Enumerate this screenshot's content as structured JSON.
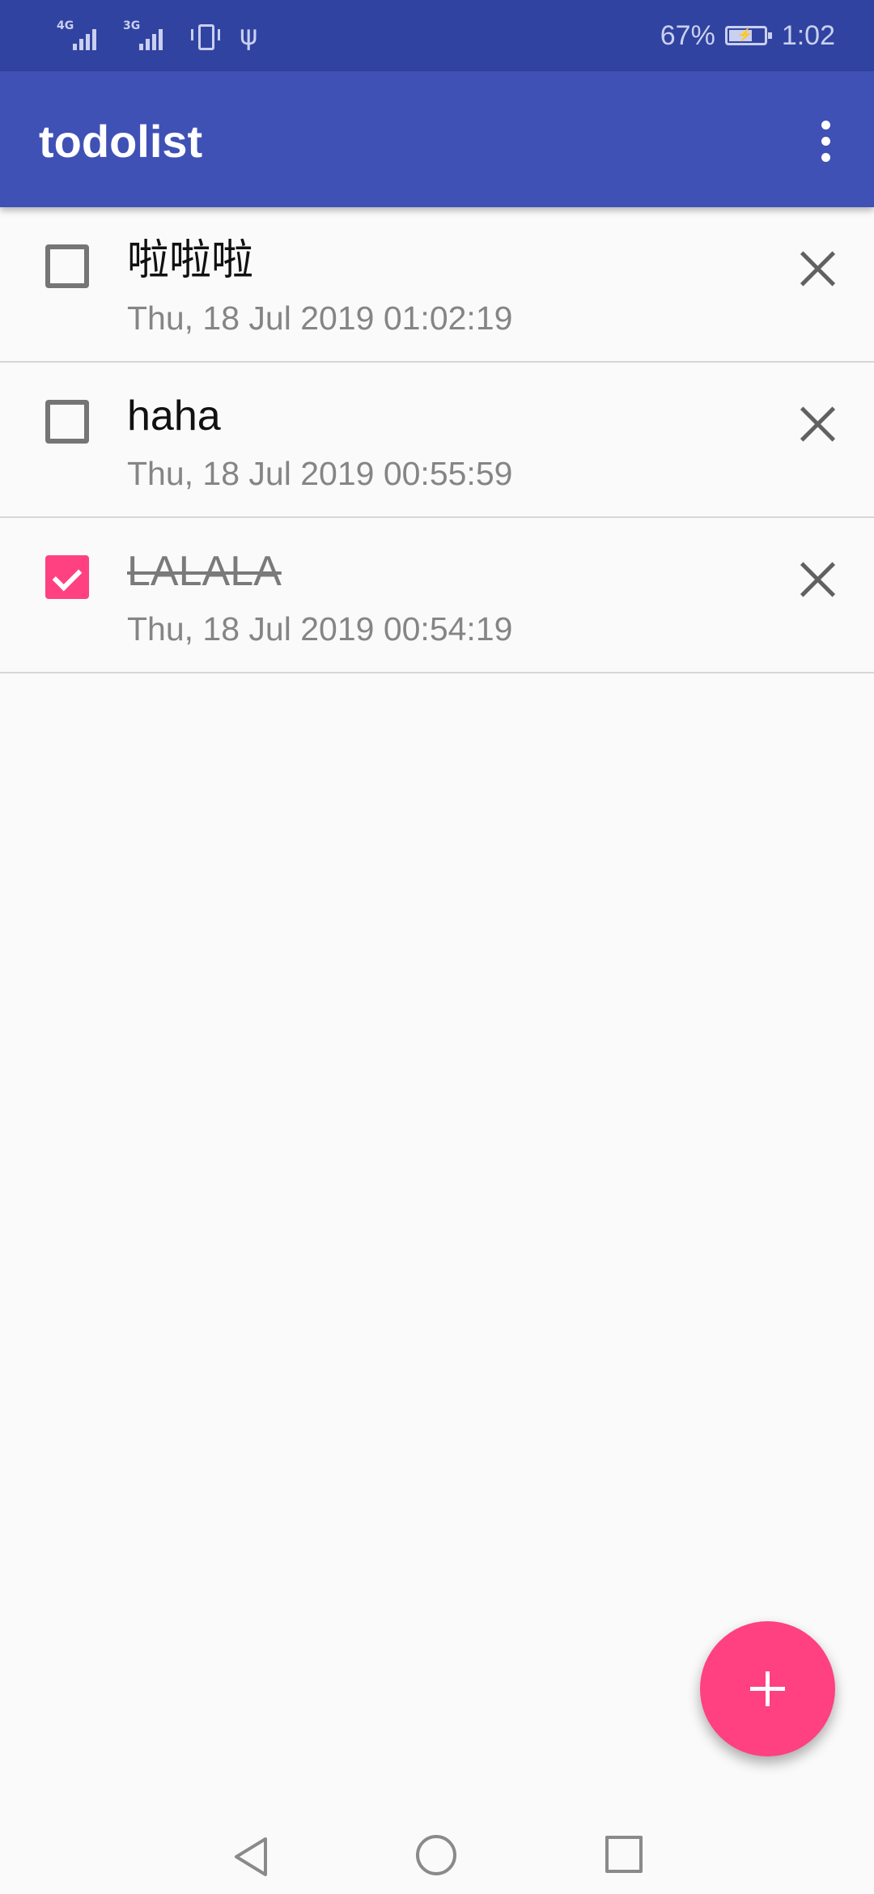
{
  "status_bar": {
    "network_1": "4G",
    "network_2": "3G",
    "battery_percent": "67%",
    "battery_level": 0.67,
    "time": "1:02"
  },
  "app_bar": {
    "title": "todolist",
    "overflow_icon": "more-vert-icon"
  },
  "todos": [
    {
      "title": "啦啦啦",
      "date": "Thu, 18 Jul 2019 01:02:19",
      "checked": false
    },
    {
      "title": "haha",
      "date": "Thu, 18 Jul 2019 00:55:59",
      "checked": false
    },
    {
      "title": "LALALA",
      "date": "Thu, 18 Jul 2019 00:54:19",
      "checked": true
    }
  ],
  "fab": {
    "icon": "add-icon"
  },
  "nav_bar": {
    "back_icon": "back-triangle-icon",
    "home_icon": "home-circle-icon",
    "recents_icon": "recents-square-icon"
  },
  "colors": {
    "status_bar": "#3143a0",
    "primary": "#3f51b5",
    "accent": "#ff4081",
    "background": "#fafafa"
  }
}
